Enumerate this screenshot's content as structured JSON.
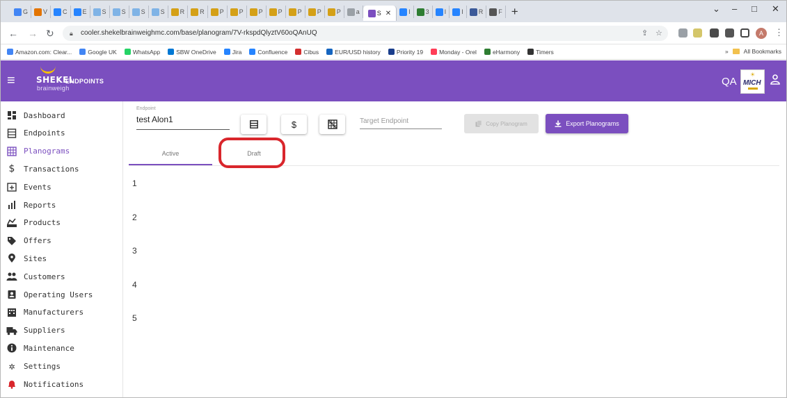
{
  "browser": {
    "tabs": [
      {
        "label": "G",
        "label2": "n",
        "color": "#4285f4"
      },
      {
        "label": "V",
        "color": "#e37400"
      },
      {
        "label": "C",
        "color": "#2684ff"
      },
      {
        "label": "E",
        "color": "#2684ff"
      },
      {
        "label": "S",
        "color": "#7fb3e6"
      },
      {
        "label": "S",
        "color": "#7fb3e6"
      },
      {
        "label": "S",
        "color": "#7fb3e6"
      },
      {
        "label": "S",
        "color": "#7fb3e6"
      },
      {
        "label": "R",
        "color": "#d4a017"
      },
      {
        "label": "R",
        "color": "#d4a017"
      },
      {
        "label": "P",
        "color": "#d4a017"
      },
      {
        "label": "P",
        "color": "#d4a017"
      },
      {
        "label": "P",
        "color": "#d4a017"
      },
      {
        "label": "P",
        "color": "#d4a017"
      },
      {
        "label": "P",
        "color": "#d4a017"
      },
      {
        "label": "P",
        "color": "#d4a017"
      },
      {
        "label": "P",
        "color": "#d4a017"
      },
      {
        "label": "a",
        "color": "#9aa0a6"
      }
    ],
    "active_tab": {
      "label": "S",
      "color": "#7b4fbf"
    },
    "after_tabs": [
      {
        "label": "I",
        "color": "#2684ff"
      },
      {
        "label": "3",
        "color": "#2e7d32"
      },
      {
        "label": "I",
        "color": "#2684ff"
      },
      {
        "label": "I",
        "color": "#2684ff"
      },
      {
        "label": "R",
        "color": "#3b5998"
      },
      {
        "label": "F",
        "color": "#555555"
      }
    ],
    "url": "cooler.shekelbrainweighmc.com/base/planogram/7V-rkspdQlyztV60oQAnUQ",
    "window_controls": {
      "minimize": "–",
      "maximize": "□",
      "close": "✕",
      "chevron": "⌄"
    }
  },
  "bookmarks": {
    "items": [
      {
        "label": "Amazon.com: Clear...",
        "color": "#4285f4"
      },
      {
        "label": "Google UK",
        "color": "#4285f4"
      },
      {
        "label": "WhatsApp",
        "color": "#25d366"
      },
      {
        "label": "SBW OneDrive",
        "color": "#0078d4"
      },
      {
        "label": "Jira",
        "color": "#2684ff"
      },
      {
        "label": "Confluence",
        "color": "#2684ff"
      },
      {
        "label": "Cibus",
        "color": "#d32f2f"
      },
      {
        "label": "EUR/USD history",
        "color": "#1565c0"
      },
      {
        "label": "Priority 19",
        "color": "#1a3e8c"
      },
      {
        "label": "Monday - Orel",
        "color": "#ff3d57"
      },
      {
        "label": "eHarmony",
        "color": "#2e7d32"
      },
      {
        "label": "Timers",
        "color": "#333333"
      }
    ],
    "more": "»",
    "all_bookmarks": "All Bookmarks"
  },
  "header": {
    "logo_main": "SHEKEL",
    "logo_sub": "brainweigh",
    "title": "ENDPOINTS",
    "env": "QA",
    "mich_logo": "MICH",
    "brand_color": "#7b4fbf"
  },
  "sidebar": {
    "items": [
      {
        "label": "Dashboard",
        "icon": "dashboard-icon"
      },
      {
        "label": "Endpoints",
        "icon": "endpoints-icon"
      },
      {
        "label": "Planograms",
        "icon": "planogram-icon",
        "active": true
      },
      {
        "label": "Transactions",
        "icon": "dollar-icon"
      },
      {
        "label": "Events",
        "icon": "calendar-plus-icon"
      },
      {
        "label": "Reports",
        "icon": "bar-chart-icon"
      },
      {
        "label": "Products",
        "icon": "products-icon"
      },
      {
        "label": "Offers",
        "icon": "tag-icon"
      },
      {
        "label": "Sites",
        "icon": "map-pin-icon"
      },
      {
        "label": "Customers",
        "icon": "users-icon"
      },
      {
        "label": "Operating Users",
        "icon": "id-badge-icon"
      },
      {
        "label": "Manufacturers",
        "icon": "building-icon"
      },
      {
        "label": "Suppliers",
        "icon": "truck-icon"
      },
      {
        "label": "Maintenance",
        "icon": "info-icon"
      },
      {
        "label": "Settings",
        "icon": "gear-icon"
      },
      {
        "label": "Notifications",
        "icon": "bell-icon"
      }
    ]
  },
  "main": {
    "endpoint_label": "Endpoint",
    "endpoint_value": "test Alon1",
    "target_placeholder": "Target Endpoint",
    "copy_button": "Copy Planogram",
    "export_button": "Export Planograms",
    "tabs": [
      {
        "label": "Active",
        "active": true
      },
      {
        "label": "Draft",
        "active": false
      }
    ],
    "rows": [
      "1",
      "2",
      "3",
      "4",
      "5"
    ],
    "highlight_color": "#d9262c"
  }
}
